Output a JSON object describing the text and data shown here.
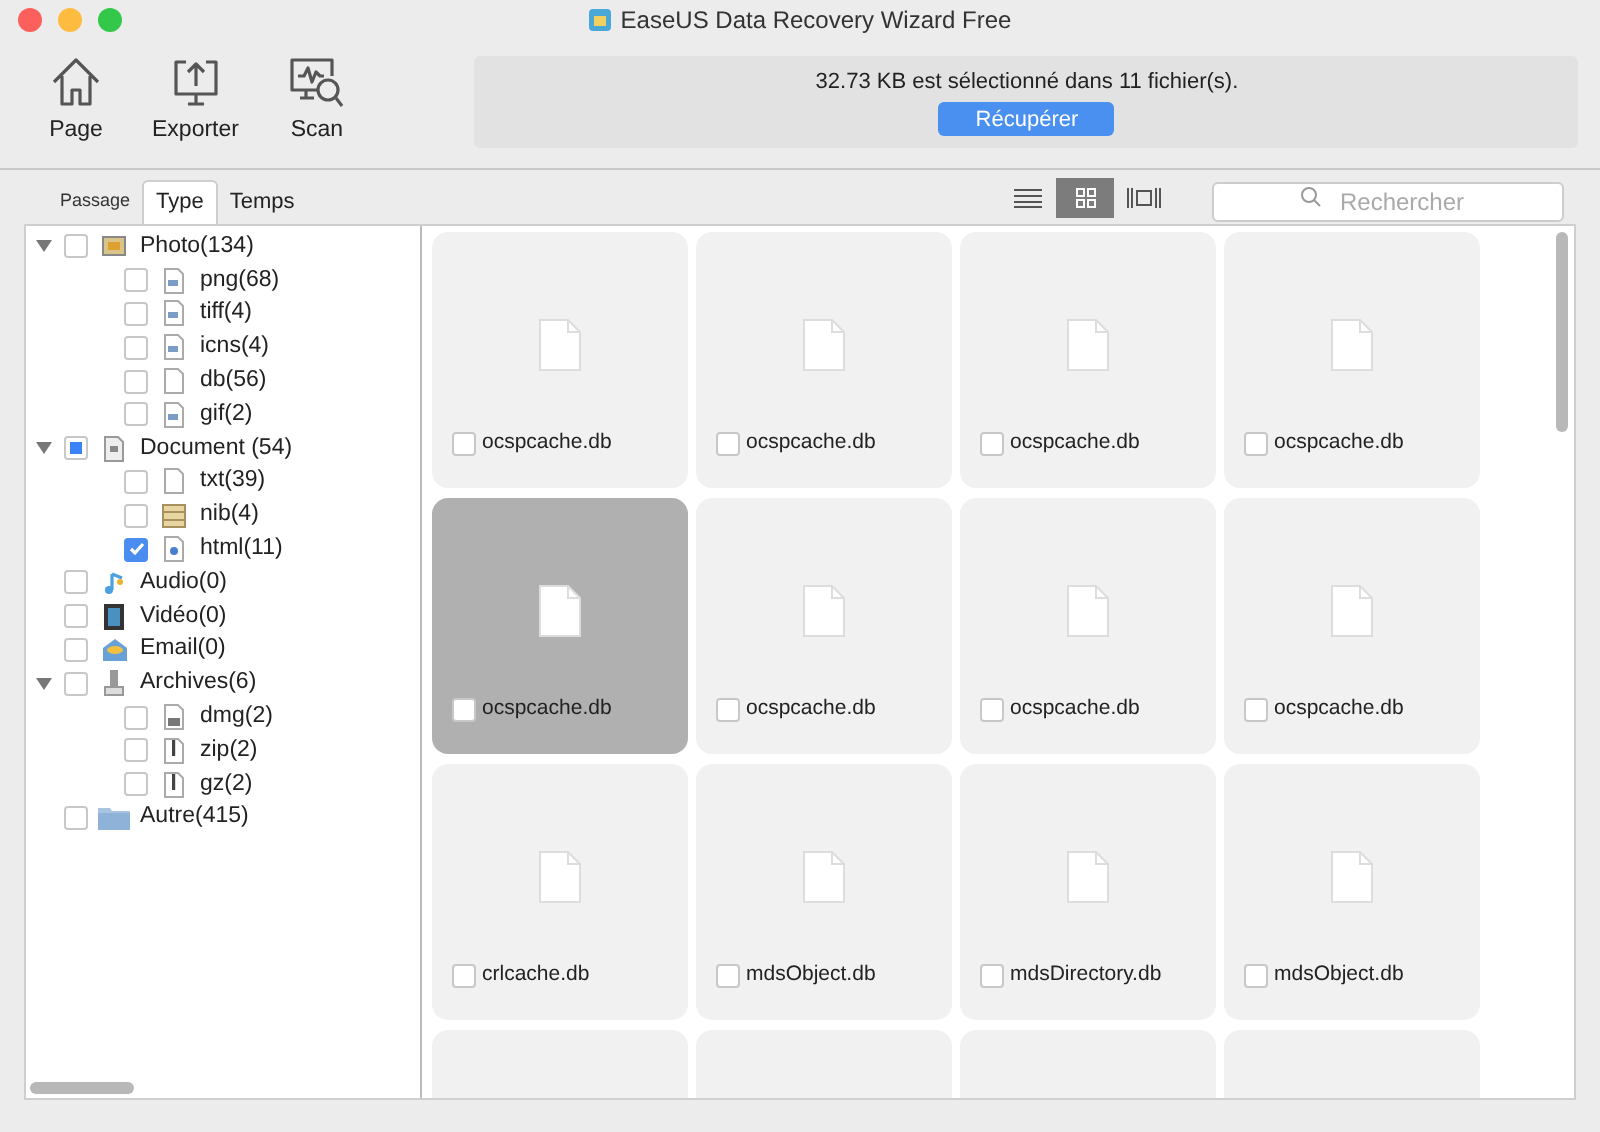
{
  "window": {
    "title": "EaseUS Data Recovery Wizard Free"
  },
  "toolbar": [
    {
      "label": "Page",
      "kind": "home"
    },
    {
      "label": "Exporter",
      "kind": "export"
    },
    {
      "label": "Scan",
      "kind": "scan"
    }
  ],
  "status": {
    "message": "32.73 KB est sélectionné dans 11 fichier(s).",
    "button": "Récupérer"
  },
  "tabs": [
    {
      "label": "Passage",
      "selected": false
    },
    {
      "label": "Type",
      "selected": true
    },
    {
      "label": "Temps",
      "selected": false
    }
  ],
  "view_modes": [
    {
      "kind": "list",
      "selected": false
    },
    {
      "kind": "grid",
      "selected": true
    },
    {
      "kind": "coverflow",
      "selected": false
    }
  ],
  "search": {
    "placeholder": "Rechercher"
  },
  "tree": [
    {
      "label": "Photo(134)",
      "kind": "image",
      "checked": false,
      "partial": false,
      "expanded": true,
      "children": [
        {
          "label": "png(68)",
          "kind": "imgfile",
          "checked": false,
          "partial": false
        },
        {
          "label": "tiff(4)",
          "kind": "imgfile",
          "checked": false,
          "partial": false
        },
        {
          "label": "icns(4)",
          "kind": "imgfile",
          "checked": false,
          "partial": false
        },
        {
          "label": "db(56)",
          "kind": "file",
          "checked": false,
          "partial": false
        },
        {
          "label": "gif(2)",
          "kind": "imgfile",
          "checked": false,
          "partial": false
        }
      ]
    },
    {
      "label": "Document (54)",
      "kind": "doc",
      "checked": false,
      "partial": true,
      "expanded": true,
      "children": [
        {
          "label": "txt(39)",
          "kind": "file",
          "checked": false,
          "partial": false
        },
        {
          "label": "nib(4)",
          "kind": "nib",
          "checked": false,
          "partial": false
        },
        {
          "label": "html(11)",
          "kind": "html",
          "checked": true,
          "partial": false
        }
      ]
    },
    {
      "label": "Audio(0)",
      "kind": "audio",
      "checked": false,
      "partial": false
    },
    {
      "label": "Vidéo(0)",
      "kind": "video",
      "checked": false,
      "partial": false
    },
    {
      "label": "Email(0)",
      "kind": "email",
      "checked": false,
      "partial": false
    },
    {
      "label": "Archives(6)",
      "kind": "archive",
      "checked": false,
      "partial": false,
      "expanded": true,
      "children": [
        {
          "label": "dmg(2)",
          "kind": "disk",
          "checked": false,
          "partial": false
        },
        {
          "label": "zip(2)",
          "kind": "zip",
          "checked": false,
          "partial": false
        },
        {
          "label": "gz(2)",
          "kind": "zip",
          "checked": false,
          "partial": false
        }
      ]
    },
    {
      "label": "Autre(415)",
      "kind": "folder",
      "checked": false,
      "partial": false
    }
  ],
  "files": [
    {
      "name": "ocspcache.db",
      "selected": false,
      "checked": false
    },
    {
      "name": "ocspcache.db",
      "selected": false,
      "checked": false
    },
    {
      "name": "ocspcache.db",
      "selected": false,
      "checked": false
    },
    {
      "name": "ocspcache.db",
      "selected": false,
      "checked": false
    },
    {
      "name": "ocspcache.db",
      "selected": true,
      "checked": false
    },
    {
      "name": "ocspcache.db",
      "selected": false,
      "checked": false
    },
    {
      "name": "ocspcache.db",
      "selected": false,
      "checked": false
    },
    {
      "name": "ocspcache.db",
      "selected": false,
      "checked": false
    },
    {
      "name": "crlcache.db",
      "selected": false,
      "checked": false
    },
    {
      "name": "mdsObject.db",
      "selected": false,
      "checked": false
    },
    {
      "name": "mdsDirectory.db",
      "selected": false,
      "checked": false
    },
    {
      "name": "mdsObject.db",
      "selected": false,
      "checked": false
    },
    {
      "selected": false
    },
    {
      "selected": false
    },
    {
      "selected": false
    },
    {
      "selected": false
    }
  ]
}
